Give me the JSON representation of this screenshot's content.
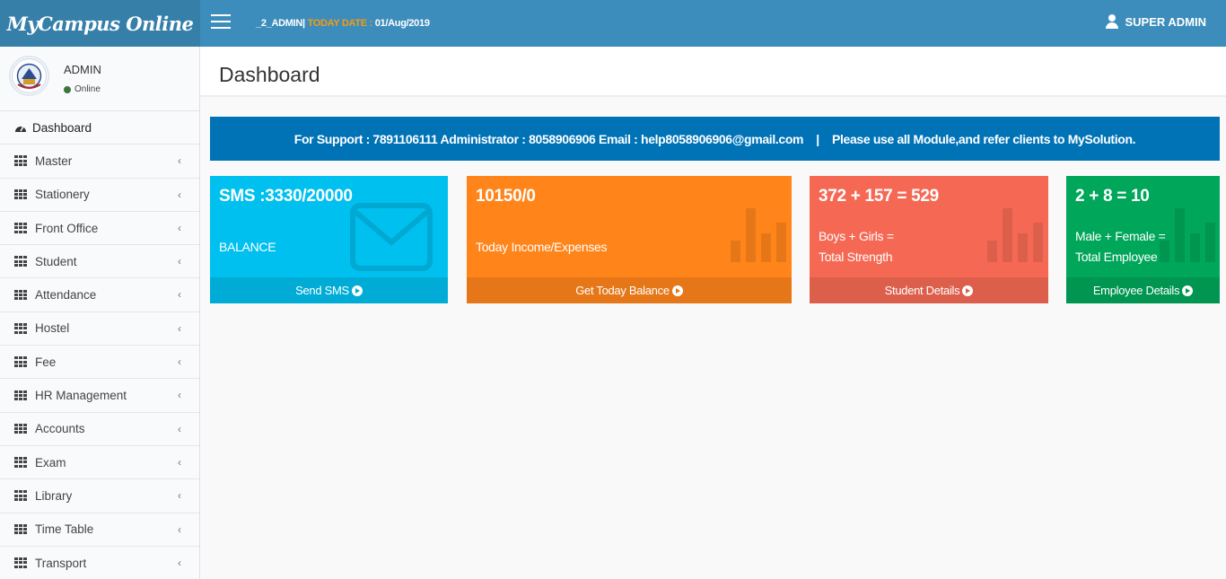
{
  "app": {
    "logo": "MyCampus Online"
  },
  "topbar": {
    "user_code": "_2_ADMIN",
    "separator": "|",
    "date_label": "TODAY DATE :",
    "date_value": "01/Aug/2019",
    "user_menu": "SUPER ADMIN"
  },
  "user_panel": {
    "name": "ADMIN",
    "status": "Online"
  },
  "sidebar": {
    "items": [
      {
        "label": "Dashboard"
      },
      {
        "label": "Master"
      },
      {
        "label": "Stationery"
      },
      {
        "label": "Front Office"
      },
      {
        "label": "Student"
      },
      {
        "label": "Attendance"
      },
      {
        "label": "Hostel"
      },
      {
        "label": "Fee"
      },
      {
        "label": "HR Management"
      },
      {
        "label": "Accounts"
      },
      {
        "label": "Exam"
      },
      {
        "label": "Library"
      },
      {
        "label": "Time Table"
      },
      {
        "label": "Transport"
      }
    ],
    "chevron": "‹"
  },
  "page": {
    "title": "Dashboard"
  },
  "support": {
    "text": "For Support : 7891106111 Administrator : 8058906906 Email : help8058906906@gmail.com    |    Please use all Module,and refer clients to MySolution."
  },
  "boxes": [
    {
      "value": "SMS :3330/20000",
      "label": "BALANCE",
      "footer": "Send SMS",
      "color": "#00c0ef"
    },
    {
      "value": "10150/0",
      "label": "Today Income/Expenses",
      "footer": "Get Today Balance",
      "color": "#ff851b"
    },
    {
      "value": "372 + 157 = 529",
      "label_line1": "Boys + Girls =",
      "label_line2": "Total Strength",
      "footer": "Student Details",
      "color": "#f56954"
    },
    {
      "value": "2 + 8 = 10",
      "label_line1": "Male + Female =",
      "label_line2": "Total Employee",
      "footer": "Employee Details",
      "color": "#00a65a"
    }
  ]
}
